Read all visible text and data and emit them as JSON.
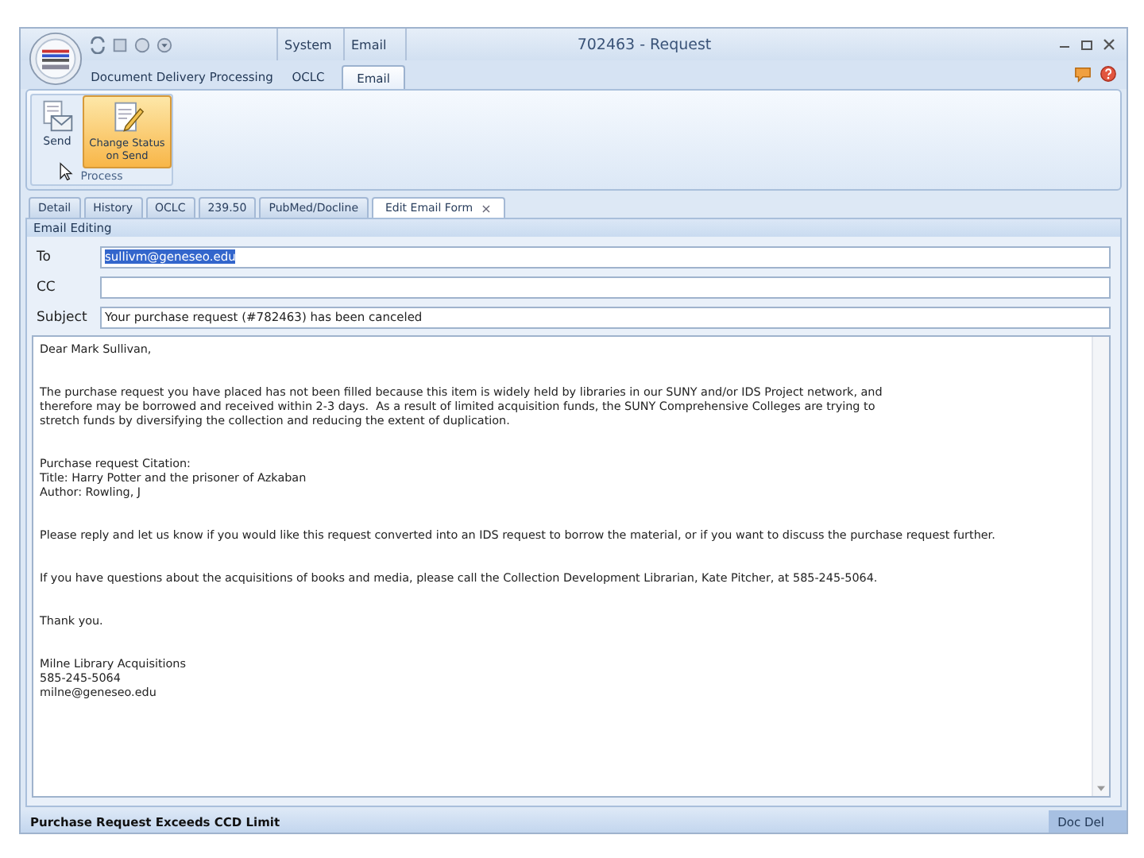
{
  "window": {
    "title": "702463 - Request"
  },
  "context_groups": [
    {
      "label": "System"
    },
    {
      "label": "Email"
    }
  ],
  "ribbon_tabs": [
    {
      "label": "Document Delivery Processing",
      "selected": false
    },
    {
      "label": "OCLC",
      "selected": false
    },
    {
      "label": "Email",
      "selected": true
    }
  ],
  "ribbon": {
    "groups": [
      {
        "label": "Process",
        "buttons": [
          {
            "label": "Send",
            "kind": "send",
            "highlighted": false
          },
          {
            "label": "Change Status on Send",
            "kind": "edit",
            "highlighted": true
          }
        ]
      }
    ]
  },
  "doc_tabs": [
    {
      "label": "Detail",
      "selected": false
    },
    {
      "label": "History",
      "selected": false
    },
    {
      "label": "OCLC",
      "selected": false
    },
    {
      "label": "239.50",
      "selected": false
    },
    {
      "label": "PubMed/Docline",
      "selected": false
    },
    {
      "label": "Edit Email Form",
      "selected": true,
      "close_glyph": "×"
    }
  ],
  "email_form": {
    "title": "Email Editing",
    "fields": [
      {
        "label": "To",
        "value": "sullivm@geneseo.edu",
        "text_selected": true
      },
      {
        "label": "CC"
      },
      {
        "label": "Subject",
        "value": "Your purchase request (#782463) has been canceled",
        "text_selected": false
      }
    ],
    "body": [
      [
        "Dear Mark Sullivan,"
      ],
      [
        "The purchase request you have placed has not been filled because this item is widely held by libraries in our SUNY and/or IDS Project network, and",
        "therefore may be borrowed and received within 2-3 days.  As a result of limited acquisition funds, the SUNY Comprehensive Colleges are trying to",
        "stretch funds by diversifying the collection and reducing the extent of duplication."
      ],
      [
        "Purchase request Citation:",
        "Title: Harry Potter and the prisoner of Azkaban",
        "Author: Rowling, J"
      ],
      [
        "Please reply and let us know if you would like this request converted into an IDS request to borrow the material, or if you want to discuss the purchase request further."
      ],
      [
        "If you have questions about the acquisitions of books and media, please call the Collection Development Librarian, Kate Pitcher, at 585-245-5064."
      ],
      [
        "Thank you."
      ],
      [
        "Milne Library Acquisitions",
        "585-245-5064",
        "milne@geneseo.edu"
      ]
    ]
  },
  "status_bar": {
    "message": "Purchase Request Exceeds CCD Limit",
    "right": "Doc Del"
  }
}
